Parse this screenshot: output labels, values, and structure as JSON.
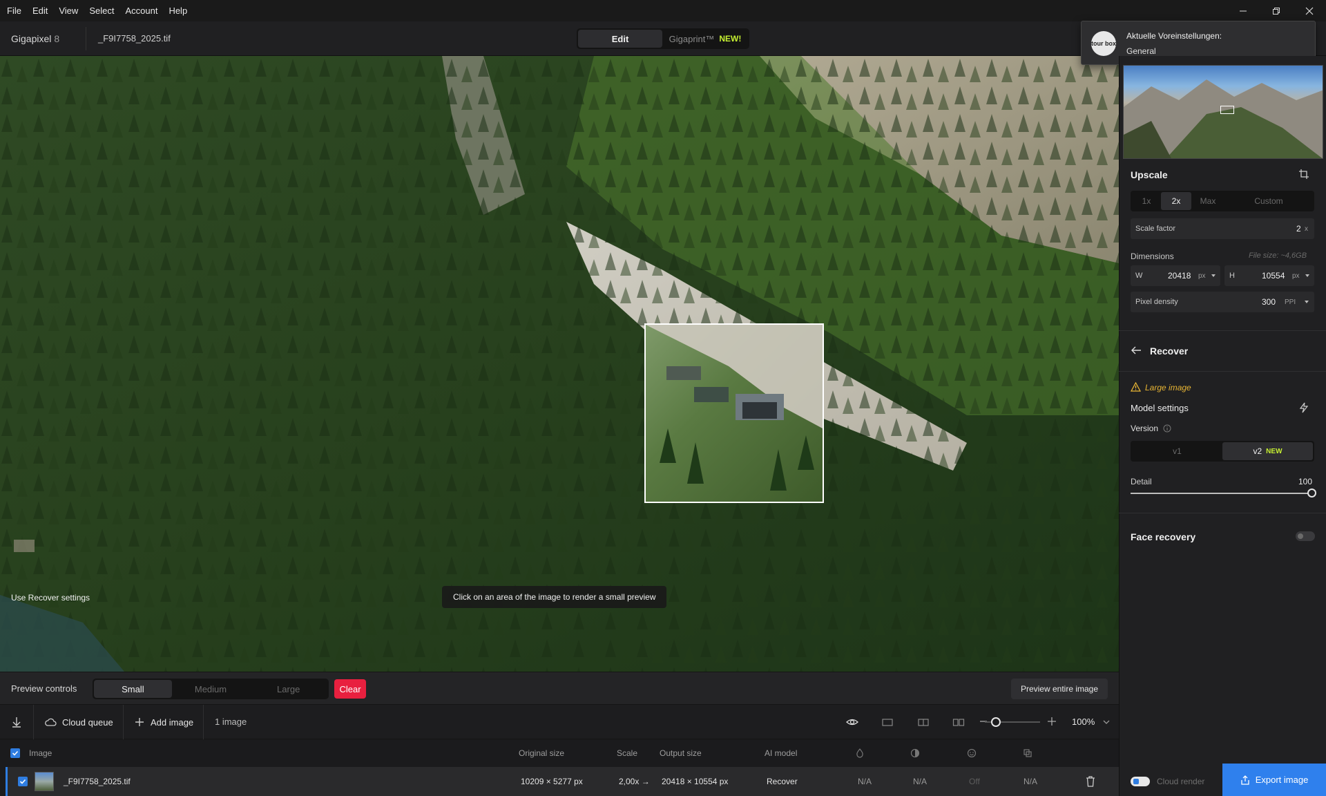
{
  "menu": [
    "File",
    "Edit",
    "View",
    "Select",
    "Account",
    "Help"
  ],
  "header": {
    "app_name": "Gigapixel",
    "app_version": "8",
    "file_name": "_F9I7758_2025.tif",
    "mode_edit": "Edit",
    "mode_gigaprint": "Gigaprint™",
    "mode_gigaprint_badge": "NEW!"
  },
  "toast": {
    "logo_text": "tour box",
    "title": "Aktuelle Voreinstellungen:",
    "subtitle": "General"
  },
  "canvas": {
    "use_recover": "Use Recover settings",
    "hint": "Click on an area of the image to render a small preview"
  },
  "preview_controls": {
    "label": "Preview controls",
    "sizes": [
      "Small",
      "Medium",
      "Large"
    ],
    "active_size": "Small",
    "clear": "Clear",
    "preview_all": "Preview entire image"
  },
  "queue": {
    "cloud_queue": "Cloud queue",
    "add_image": "Add image",
    "count": "1 image",
    "zoom": "100%",
    "zoom_level": 0.2
  },
  "table": {
    "headers": {
      "image": "Image",
      "original": "Original size",
      "scale": "Scale",
      "output": "Output size",
      "model": "AI model"
    },
    "row": {
      "name": "_F9I7758_2025.tif",
      "original": "10209 × 5277 px",
      "scale": "2,00x →",
      "output": "20418 × 10554 px",
      "model": "Recover",
      "c1": "N/A",
      "c2": "N/A",
      "c3": "Off",
      "c4": "N/A"
    }
  },
  "upscale": {
    "title": "Upscale",
    "options": [
      "1x",
      "2x",
      "Max",
      "Custom"
    ],
    "active": "2x",
    "scale_label": "Scale factor",
    "scale_value": "2",
    "scale_unit": "x",
    "dimensions_label": "Dimensions",
    "file_size": "File size: ~4,6GB",
    "w_label": "W",
    "w_value": "20418",
    "w_unit": "px",
    "h_label": "H",
    "h_value": "10554",
    "h_unit": "px",
    "density_label": "Pixel density",
    "density_value": "300",
    "density_unit": "PPI"
  },
  "recover": {
    "title": "Recover",
    "warning": "Large image",
    "model_settings": "Model settings",
    "version_label": "Version",
    "versions": [
      "v1",
      "v2"
    ],
    "active_version": "v2",
    "v2_badge": "NEW",
    "detail_label": "Detail",
    "detail_value": "100",
    "face_recovery": "Face recovery"
  },
  "footer": {
    "cloud_render": "Cloud render",
    "export": "Export image"
  },
  "colors": {
    "accent": "#2f80ed",
    "danger": "#e8203f",
    "new_badge": "#c6f032",
    "warning": "#e8b534"
  }
}
